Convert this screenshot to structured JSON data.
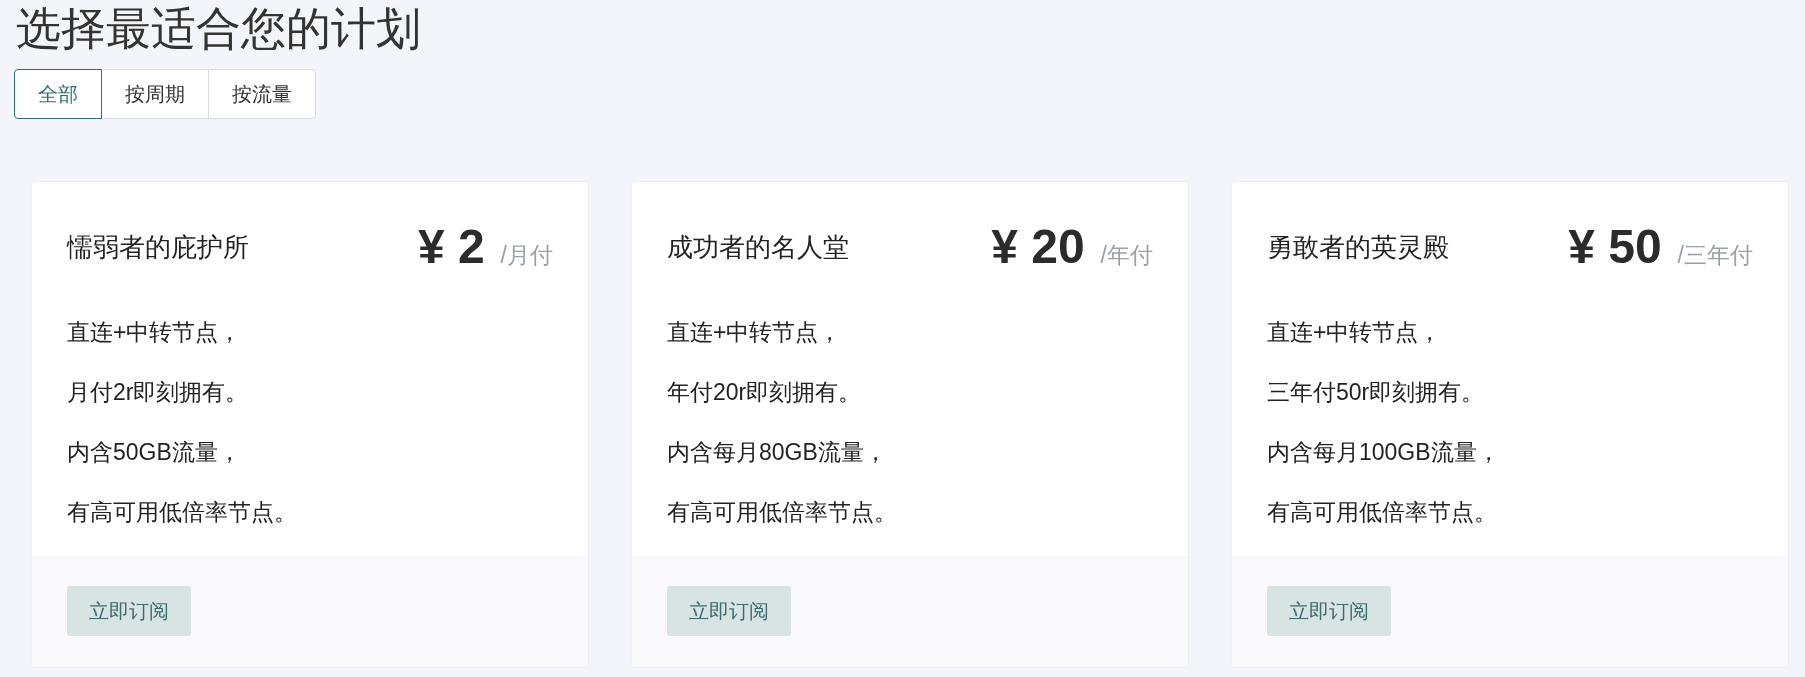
{
  "heading": "选择最适合您的计划",
  "tabs": [
    {
      "label": "全部",
      "selected": true
    },
    {
      "label": "按周期",
      "selected": false
    },
    {
      "label": "按流量",
      "selected": false
    }
  ],
  "plans": [
    {
      "name": "懦弱者的庇护所",
      "price": "¥ 2",
      "period": "/月付",
      "features": [
        "直连+中转节点，",
        "月付2r即刻拥有。",
        "内含50GB流量，",
        "有高可用低倍率节点。"
      ],
      "button": "立即订阅"
    },
    {
      "name": "成功者的名人堂",
      "price": "¥ 20",
      "period": "/年付",
      "features": [
        "直连+中转节点，",
        "年付20r即刻拥有。",
        "内含每月80GB流量，",
        "有高可用低倍率节点。"
      ],
      "button": "立即订阅"
    },
    {
      "name": "勇敢者的英灵殿",
      "price": "¥ 50",
      "period": "/三年付",
      "features": [
        "直连+中转节点，",
        "三年付50r即刻拥有。",
        "内含每月100GB流量，",
        "有高可用低倍率节点。"
      ],
      "button": "立即订阅"
    }
  ]
}
